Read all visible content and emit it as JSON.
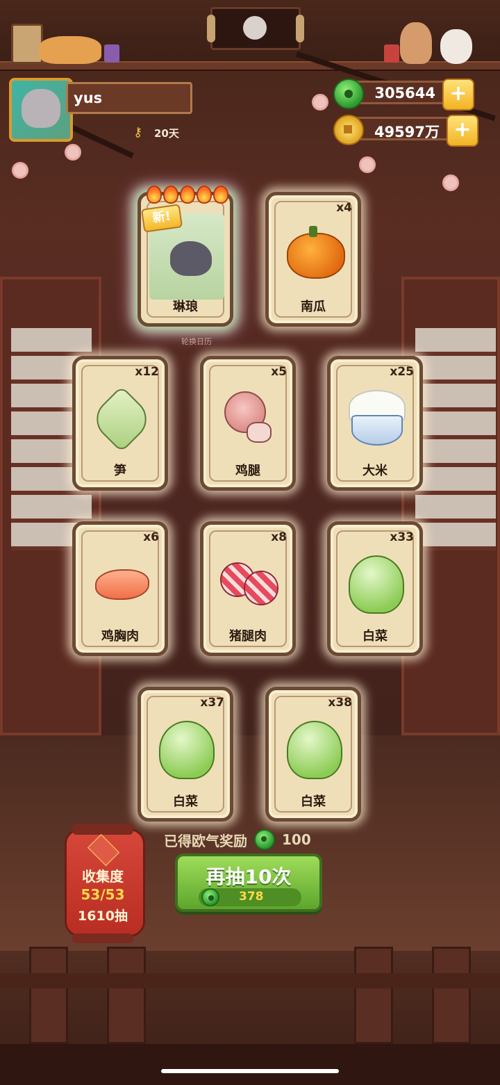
{
  "profile": {
    "name": "yus",
    "days": "20天"
  },
  "currency": {
    "jade": "305644",
    "coins": "49597万"
  },
  "cards": [
    {
      "label": "琳琅",
      "count": "",
      "is_new": true,
      "new_tag": "新!",
      "icon": "wolf-character-icon"
    },
    {
      "label": "南瓜",
      "count": "x4",
      "icon": "pumpkin-icon"
    },
    {
      "label": "笋",
      "count": "x12",
      "icon": "bamboo-shoot-icon"
    },
    {
      "label": "鸡腿",
      "count": "x5",
      "icon": "chicken-leg-icon"
    },
    {
      "label": "大米",
      "count": "x25",
      "icon": "rice-bowl-icon"
    },
    {
      "label": "鸡胸肉",
      "count": "x6",
      "icon": "chicken-breast-icon"
    },
    {
      "label": "猪腿肉",
      "count": "x8",
      "icon": "pork-leg-icon"
    },
    {
      "label": "白菜",
      "count": "x33",
      "icon": "cabbage-icon"
    },
    {
      "label": "白菜",
      "count": "x37",
      "icon": "cabbage-icon"
    },
    {
      "label": "白菜",
      "count": "x38",
      "icon": "cabbage-icon"
    }
  ],
  "background_text": "轮换日历",
  "collection": {
    "title": "收集度",
    "progress": "53/53",
    "draws": "1610抽"
  },
  "reward": {
    "label": "已得欧气奖励",
    "value": "100"
  },
  "draw_button": {
    "label": "再抽10次",
    "cost": "378"
  },
  "colors": {
    "jade_green": "#2c9a2e",
    "gold": "#f2b322",
    "card_bg": "#efdfb9",
    "button_green": "#5ca62c",
    "lantern_red": "#c9382c"
  }
}
